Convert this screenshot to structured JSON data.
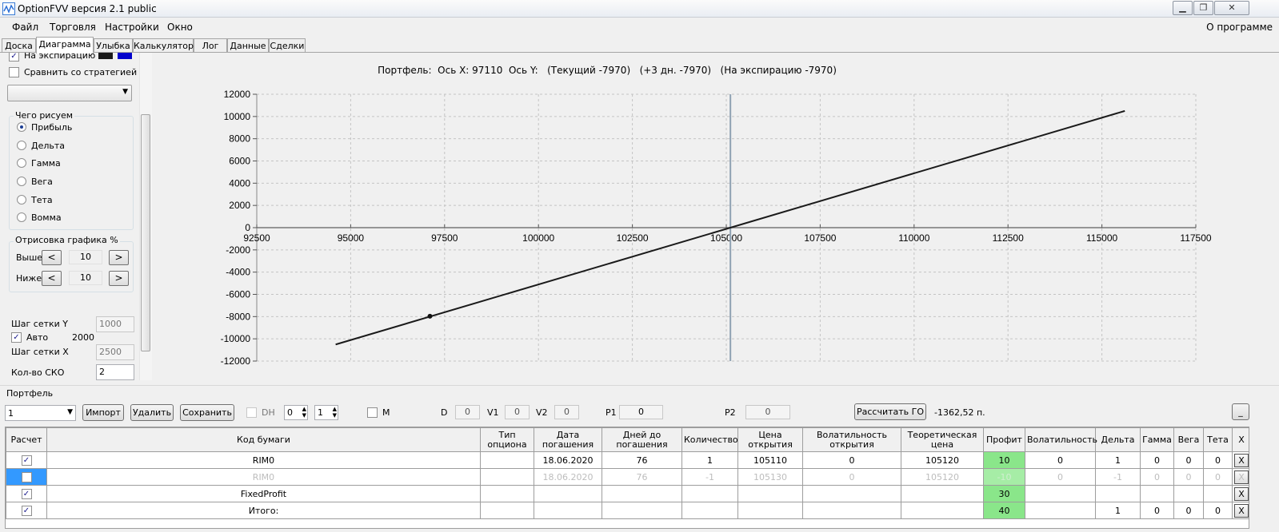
{
  "window": {
    "title": "OptionFVV версия 2.1 public",
    "minimize": "▁",
    "restore": "❐",
    "close": "✕"
  },
  "menu": {
    "items": [
      "Файл",
      "Торговля",
      "Настройки",
      "Окно"
    ],
    "about": "О программе"
  },
  "tabs": [
    "Доска",
    "Диаграмма",
    "Улыбка",
    "Калькулятор",
    "Лог",
    "Данные",
    "Сделки"
  ],
  "active_tab": "Диаграмма",
  "left_panel": {
    "on_expiration": {
      "label": "На экспирацию",
      "checked": true,
      "colors": [
        "#1a1a1a",
        "#0000cc"
      ]
    },
    "compare_strategy": {
      "label": "Сравнить со стратегией",
      "checked": false
    },
    "strategy_select": "",
    "draw_group": {
      "title": "Чего рисуем",
      "options": [
        "Прибыль",
        "Дельта",
        "Гамма",
        "Вега",
        "Тета",
        "Вомма"
      ],
      "selected": "Прибыль"
    },
    "draw_percent": {
      "title": "Отрисовка графика %",
      "above_label": "Выше",
      "above_value": "10",
      "below_label": "Ниже",
      "below_value": "10",
      "left": "<",
      "right": ">"
    },
    "grid_y_label": "Шаг сетки Y",
    "grid_y_value": "1000",
    "auto_label": "Авто",
    "auto_checked": true,
    "auto_value": "2000",
    "grid_x_label": "Шаг сетки X",
    "grid_x_value": "2500",
    "sko_label": "Кол-во СКО",
    "sko_value": "2"
  },
  "chart_title": "Портфель:  Ось X: 97110  Ось Y:   (Текущий -7970)   (+3 дн. -7970)   (На экспирацию -7970)",
  "chart_data": {
    "type": "line",
    "xlim": [
      92500,
      117500
    ],
    "ylim": [
      -12000,
      12000
    ],
    "x_ticks": [
      92500,
      95000,
      97500,
      100000,
      102500,
      105000,
      107500,
      110000,
      112500,
      115000,
      117500
    ],
    "y_ticks": [
      12000,
      10000,
      8000,
      6000,
      4000,
      2000,
      0,
      -2000,
      -4000,
      -6000,
      -8000,
      -10000,
      -12000
    ],
    "grid": true,
    "series": [
      {
        "color": "#1a1a1a",
        "x": [
          94600,
          105110,
          115610
        ],
        "y": [
          -10510,
          0,
          10500
        ]
      }
    ],
    "cursor_x": 105110,
    "marker": {
      "x": 97110,
      "y": -7970
    }
  },
  "portfolio": {
    "label": "Портфель",
    "select_value": "1",
    "import": "Импорт",
    "delete": "Удалить",
    "save": "Сохранить",
    "dh_label": "DH",
    "dh_checked": false,
    "spin1": "0",
    "spin2": "1",
    "m_label": "M",
    "d_label": "D",
    "d_value": "0",
    "v1_label": "V1",
    "v1_value": "0",
    "v2_label": "V2",
    "v2_value": "0",
    "p1_label": "P1",
    "p1_value": "0",
    "p2_label": "P2",
    "p2_value": "0",
    "calc_go": "Рассчитать ГО",
    "go_value": "-1362,52 п.",
    "collapse": "_"
  },
  "table": {
    "headers": [
      "Расчет",
      "Код бумаги",
      "Тип опциона",
      "Дата погашения",
      "Дней до погашения",
      "Количество",
      "Цена открытия",
      "Волатильность открытия",
      "Теоретическая цена",
      "Профит",
      "Волатильность",
      "Дельта",
      "Гамма",
      "Вега",
      "Тета",
      "X"
    ],
    "rows": [
      {
        "checked": true,
        "cells": [
          "RIM0",
          "",
          "18.06.2020",
          "76",
          "1",
          "105110",
          "0",
          "105120",
          "10",
          "0",
          "1",
          "0",
          "0",
          "0"
        ],
        "dim": false
      },
      {
        "checked": false,
        "cells": [
          "RIM0",
          "",
          "18.06.2020",
          "76",
          "-1",
          "105130",
          "0",
          "105120",
          "-10",
          "0",
          "-1",
          "0",
          "0",
          "0"
        ],
        "dim": true
      },
      {
        "checked": true,
        "cells": [
          "FixedProfit",
          "",
          "",
          "",
          "",
          "",
          "",
          "",
          "30",
          "",
          "",
          "",
          "",
          ""
        ],
        "dim": false
      },
      {
        "checked": true,
        "cells": [
          "Итого:",
          "",
          "",
          "",
          "",
          "",
          "",
          "",
          "40",
          "",
          "1",
          "0",
          "0",
          "0"
        ],
        "dim": false
      }
    ],
    "x_label": "X",
    "check_mark": "✓"
  }
}
